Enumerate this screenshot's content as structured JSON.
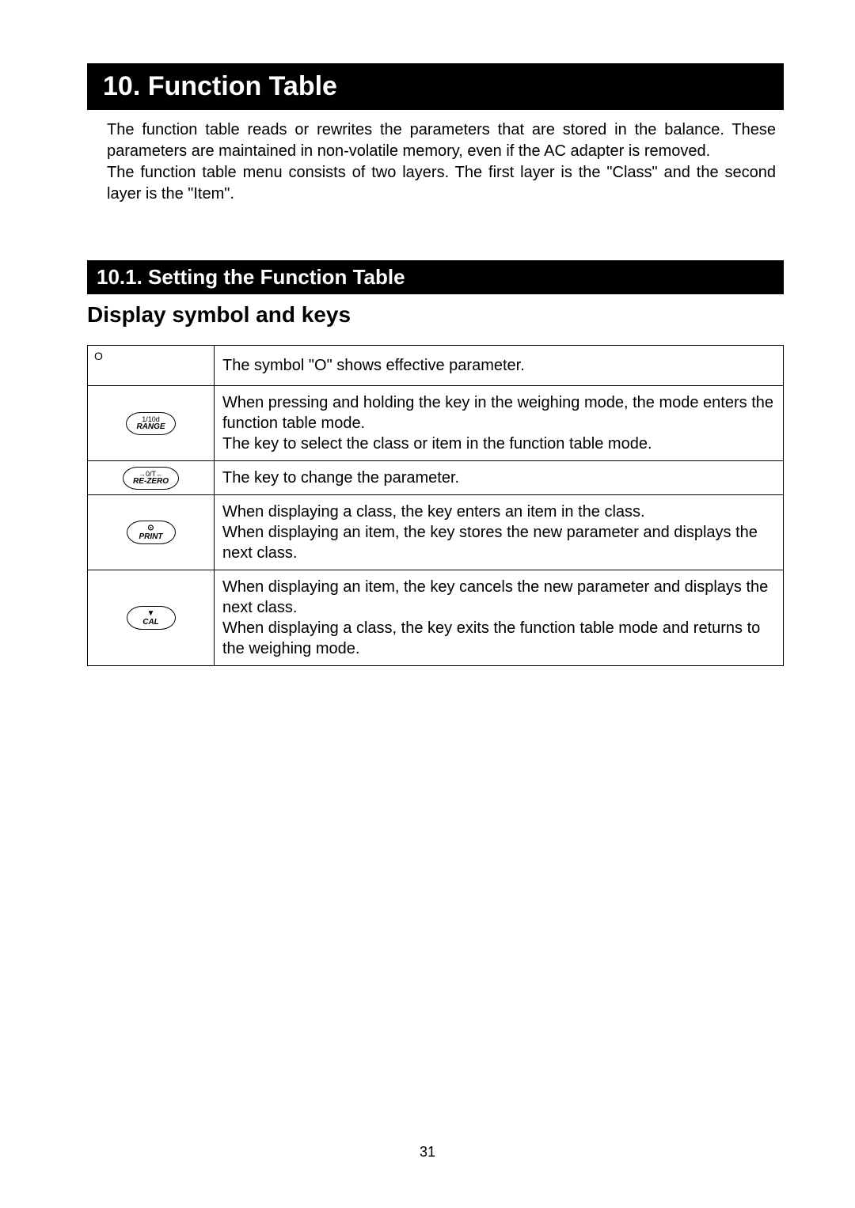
{
  "h1": "10.  Function Table",
  "intro1": "The function table reads or rewrites the parameters that are stored in the balance. These parameters are maintained in non-volatile memory, even if the AC adapter is removed.",
  "intro2": "The function table menu consists of two layers. The first layer is the \"Class\" and the second layer is the \"Item\".",
  "h2": "10.1.  Setting the Function Table",
  "h3": "Display symbol and keys",
  "rows": [
    {
      "symbol_type": "circle",
      "symbol_text": "O",
      "desc_pre": "The symbol \"",
      "desc_mid": "O",
      "desc_post": "\" shows effective parameter."
    },
    {
      "symbol_type": "key",
      "key_line1": "1/10d",
      "key_line2": "RANGE",
      "desc": "When pressing and holding the key in the weighing mode, the mode enters the function table mode.\nThe key to select the class or item in the function table mode."
    },
    {
      "symbol_type": "key",
      "key_line1": "→0/T←",
      "key_line2": "RE-ZERO",
      "desc": "The key to change the parameter."
    },
    {
      "symbol_type": "key",
      "key_icon": "⊙",
      "key_line2": "PRINT",
      "desc": "When displaying a class, the key enters an item in the class.\nWhen displaying an item, the key stores the new parameter and displays the next class."
    },
    {
      "symbol_type": "key",
      "key_icon": "▼",
      "key_line2": "CAL",
      "desc": "When displaying an item, the key cancels the new parameter and displays the next class.\nWhen displaying a class, the key exits the function table mode and returns to the weighing mode."
    }
  ],
  "page_number": "31"
}
